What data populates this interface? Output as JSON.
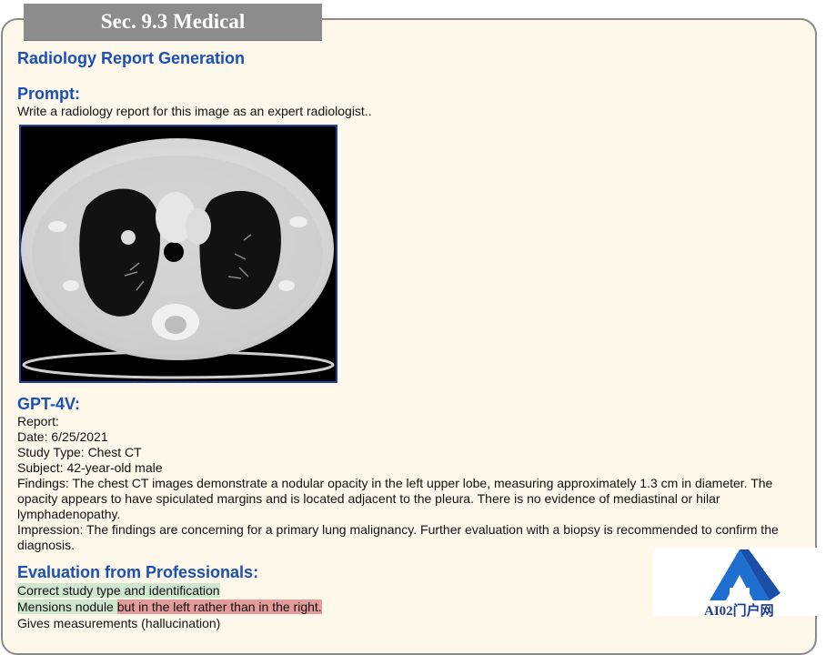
{
  "section_tab": "Sec. 9.3 Medical",
  "title": "Radiology Report Generation",
  "prompt": {
    "heading": "Prompt:",
    "text": "Write a radiology report for this image as an expert radiologist.."
  },
  "gpt4v": {
    "heading": "GPT-4V:",
    "lines": [
      "Report:",
      "Date: 6/25/2021",
      "Study Type: Chest CT",
      "Subject: 42-year-old male",
      "Findings: The chest CT images demonstrate a nodular opacity in the left upper lobe, measuring approximately 1.3 cm in diameter. The opacity appears to have spiculated margins and is located adjacent to the pleura. There is no evidence of mediastinal or hilar lymphadenopathy.",
      "Impression: The findings are concerning for a primary lung malignancy. Further evaluation with a biopsy is recommended to confirm the diagnosis."
    ]
  },
  "evaluation": {
    "heading": "Evaluation from Professionals:",
    "line1": "Correct study type and identification",
    "line2_a": "Mensions nodule ",
    "line2_b": "but in the left rather than in the right.",
    "line3": "Gives measurements (hallucination)"
  },
  "watermark": {
    "text": "AI02门户网"
  },
  "colors": {
    "heading": "#1a4fb5",
    "highlight_green": "#cfe6cf",
    "highlight_red": "#e49b9b",
    "tab_bg": "#8c8c8c",
    "panel_bg": "#fdf8ea"
  }
}
